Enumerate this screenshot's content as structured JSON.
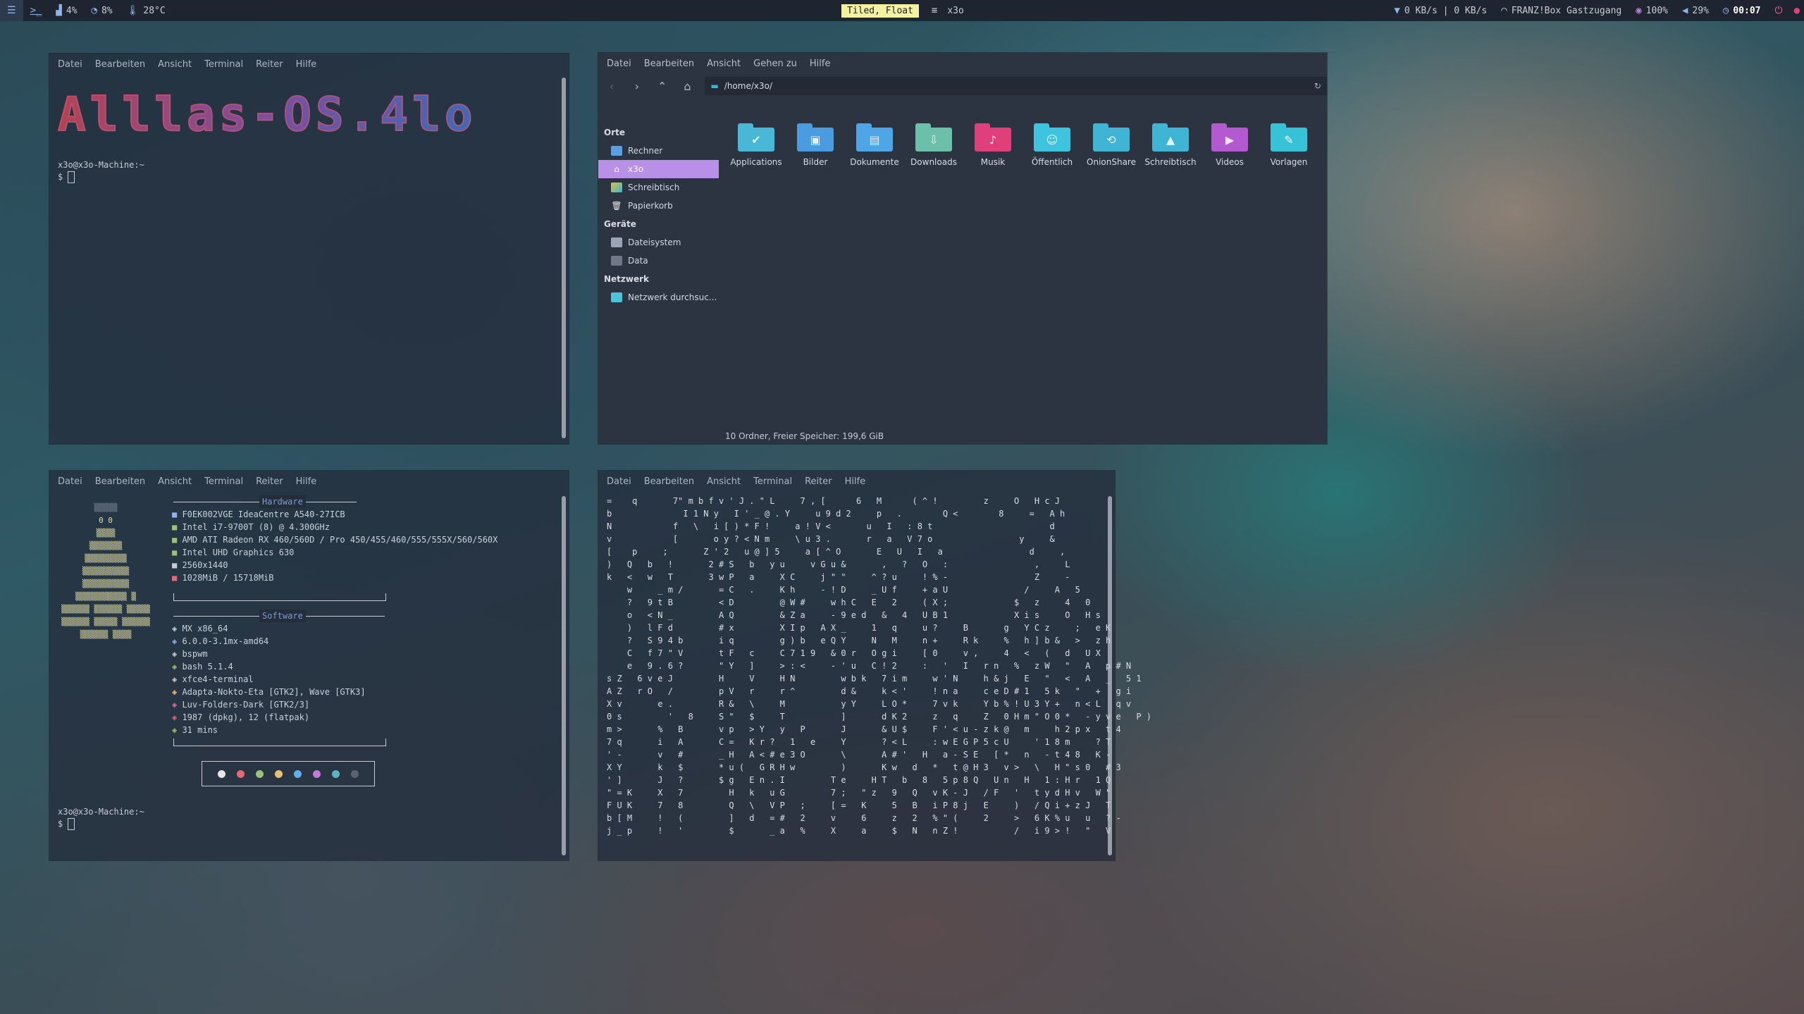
{
  "topbar": {
    "cpu": "4%",
    "ram": "8%",
    "temp": "28°C",
    "mode": "Tiled, Float",
    "window_title": "x3o",
    "net": "0 KB/s | 0 KB/s",
    "wifi": "FRANZ!Box Gastzugang",
    "brightness": "100%",
    "volume": "29%",
    "clock": "00:07",
    "colors": {
      "bar": "#1f2530",
      "mode_bg": "#f4f1a0",
      "accent": "#8fb4e8"
    }
  },
  "term_menu": [
    "Datei",
    "Bearbeiten",
    "Ansicht",
    "Terminal",
    "Reiter",
    "Hilfe"
  ],
  "term1": {
    "banner": "Alllas-OS.4lo",
    "host": "x3o@x3o-Machine:~",
    "prompt": "$"
  },
  "filemanager": {
    "menu": [
      "Datei",
      "Bearbeiten",
      "Ansicht",
      "Gehen zu",
      "Hilfe"
    ],
    "path": "/home/x3o/",
    "sections": [
      {
        "title": "Orte",
        "items": [
          {
            "label": "Rechner",
            "icon": "computer-icon",
            "color": "#5aa0e0"
          },
          {
            "label": "x3o",
            "icon": "home-icon",
            "color": "#ffffff"
          },
          {
            "label": "Schreibtisch",
            "icon": "desktop-icon",
            "color": "#5aa0e0"
          },
          {
            "label": "Papierkorb",
            "icon": "trash-icon",
            "color": "#e6e6e6"
          }
        ]
      },
      {
        "title": "Geräte",
        "items": [
          {
            "label": "Dateisystem",
            "icon": "drive-icon",
            "color": "#9aa4b2"
          },
          {
            "label": "Data",
            "icon": "drive-icon",
            "color": "#9aa4b2"
          }
        ]
      },
      {
        "title": "Netzwerk",
        "items": [
          {
            "label": "Netzwerk durchsuc...",
            "icon": "network-icon",
            "color": "#4cc3d9"
          }
        ]
      }
    ],
    "folders": [
      {
        "label": "Applications",
        "color": "#49b8d6",
        "glyph": "✔"
      },
      {
        "label": "Bilder",
        "color": "#4a9be0",
        "glyph": "▣"
      },
      {
        "label": "Dokumente",
        "color": "#4fa6e6",
        "glyph": "▤"
      },
      {
        "label": "Downloads",
        "color": "#6cbfa8",
        "glyph": "⇩"
      },
      {
        "label": "Musik",
        "color": "#e0407a",
        "glyph": "♪"
      },
      {
        "label": "Öffentlich",
        "color": "#3ec4df",
        "glyph": "☺"
      },
      {
        "label": "OnionShare",
        "color": "#3fb4d4",
        "glyph": "⟲"
      },
      {
        "label": "Schreibtisch",
        "color": "#3fb4d4",
        "glyph": "▲"
      },
      {
        "label": "Videos",
        "color": "#b35ad0",
        "glyph": "▶"
      },
      {
        "label": "Vorlagen",
        "color": "#38c2d8",
        "glyph": "✎"
      }
    ],
    "status": "10 Ordner, Freier Speicher: 199,6 GiB"
  },
  "neofetch": {
    "hardware_title": "Hardware",
    "hardware": [
      "F0EK002VGE IdeaCentre A540-27ICB",
      "Intel i7-9700T (8) @ 4.300GHz",
      "AMD ATI Radeon RX 460/560D / Pro 450/455/460/555/555X/560/560X",
      "Intel UHD Graphics 630",
      "2560x1440",
      "1028MiB / 15718MiB"
    ],
    "software_title": "Software",
    "software": [
      "MX x86_64",
      "6.0.0-3.1mx-amd64",
      "bspwm",
      "bash 5.1.4",
      "xfce4-terminal",
      "Adapta-Nokto-Eta [GTK2], Wave [GTK3]",
      "Luv-Folders-Dark [GTK2/3]",
      "1987 (dpkg), 12 (flatpak)",
      "31 mins"
    ],
    "palette": [
      "#e6e6e6",
      "#e06c75",
      "#98c379",
      "#e5c07b",
      "#61afef",
      "#c678dd",
      "#56b6c2",
      "#5c6370"
    ],
    "host": "x3o@x3o-Machine:~",
    "prompt": "$"
  },
  "matrix": {
    "lines": [
      "=    q       7\" m b f v ' J . \" L     7 , [      6   M      ( ^ !         z     O   H c J",
      "b              I 1 N y   I ' _ @ . Y     u 9 d 2     p   .        Q <        8     =   A h",
      "N            f   \\   i [ ) * F !     a ! V <       u   I   : 8 t                       d",
      "v            [       o y ? < N m     \\ u 3 .       r   a   V 7 o                 y     &",
      "[    p     ;       Z ' 2   u @ ] 5     a [ ^ O       E   U   I   a                 d     ,",
      ")   Q   b   !       2 # S   b   y u     v G u &       ,   ?   O   :                 ,     L",
      "k   <   w   T       3 w P   a     X C     j \" \"     ^ ? u     ! % -                 Z     -",
      "    w     _ m /       = C   .     K h     - ! D     _ U f     + a U               /     A   5",
      "    ?   9 t B         < D         @ W #     w h C   E   2     ( X ;             $   z     4   0",
      "    o   < N _         A Q         & Z a     - 9 e d   &   4   U B 1             X i s     O   H s",
      "    )   l F d         # x         X I p   A X _     1   q     u ?     B       g   Y C z     ;   e K",
      "    ?   S 9 4 b       i q         g ) b   e Q Y     N   M     n +     R k     %   h ] b &   >   z h",
      "    C   f 7 \" V       t F   c     C 7 1 9   & 0 r   O g i     [ 0     v ,     4   <   (   d   U X",
      "    e   9 . 6 ?       \" Y   ]     > : <     - ' u   C ! 2     :   '   I   r n   %   z W   \"   A   p # N",
      "s Z   6 v e J         H     V     H N         w b k   7 i m     w ' N     h & j   E   \"   <   A   _   5 1",
      "A Z   r O   /         p V   r     r ^         d &     k < '     ! n a     c e D # 1   5 k   \"   +   g i",
      "X v       e .         R &   \\     M           y Y     L O *     7 v k     Y b % ! U 3 Y +   n < L   q v",
      "0 s         '   8     S \"   $     T           ]       d K 2     z   q     Z   0 H m \" O 0 *   - y v e   P )",
      "m >       %   B       v p   > Y   y   P       J       & U $     F ' < u - z k @   m     h 2 p x   t 4",
      "7 q       i   A       C =   K r ?   1   e     Y       ? < L     : w E G P 5 c U     ' 1 8 m     ? T",
      "' -       v   #       _ H   A < # e 3 O       \\       A # '   H   a - S E   [ *   n   - t 4 8   K -",
      "X Y       k   $       * u (   G R H w         )       K w   d   *   t @ H 3   v >   \\   H \" s 0   # 3",
      "' ]       J   ?       $ g   E n . I         T e     H T   b   8   5 p 8 Q   U n   H   1 : H r   1 Q",
      "\" = K     X   7         H   k   u G         7 ;   \" z   9   Q   v K - J   / F   '   t y d H v   W \"",
      "F U K     7   8         Q   \\   V P   ;     [ =   K     5   B   i P 8 j   E     )   / Q i + z J   T",
      "b [ M     !   (         ]   d   = #   2     v     6     z   2   % \" (     2     >   6 K % u   u   ? -",
      "j _ p     !   '         $       _ a   %     X     a     $   N   n Z !           /   i 9 > !   \"   V"
    ]
  }
}
